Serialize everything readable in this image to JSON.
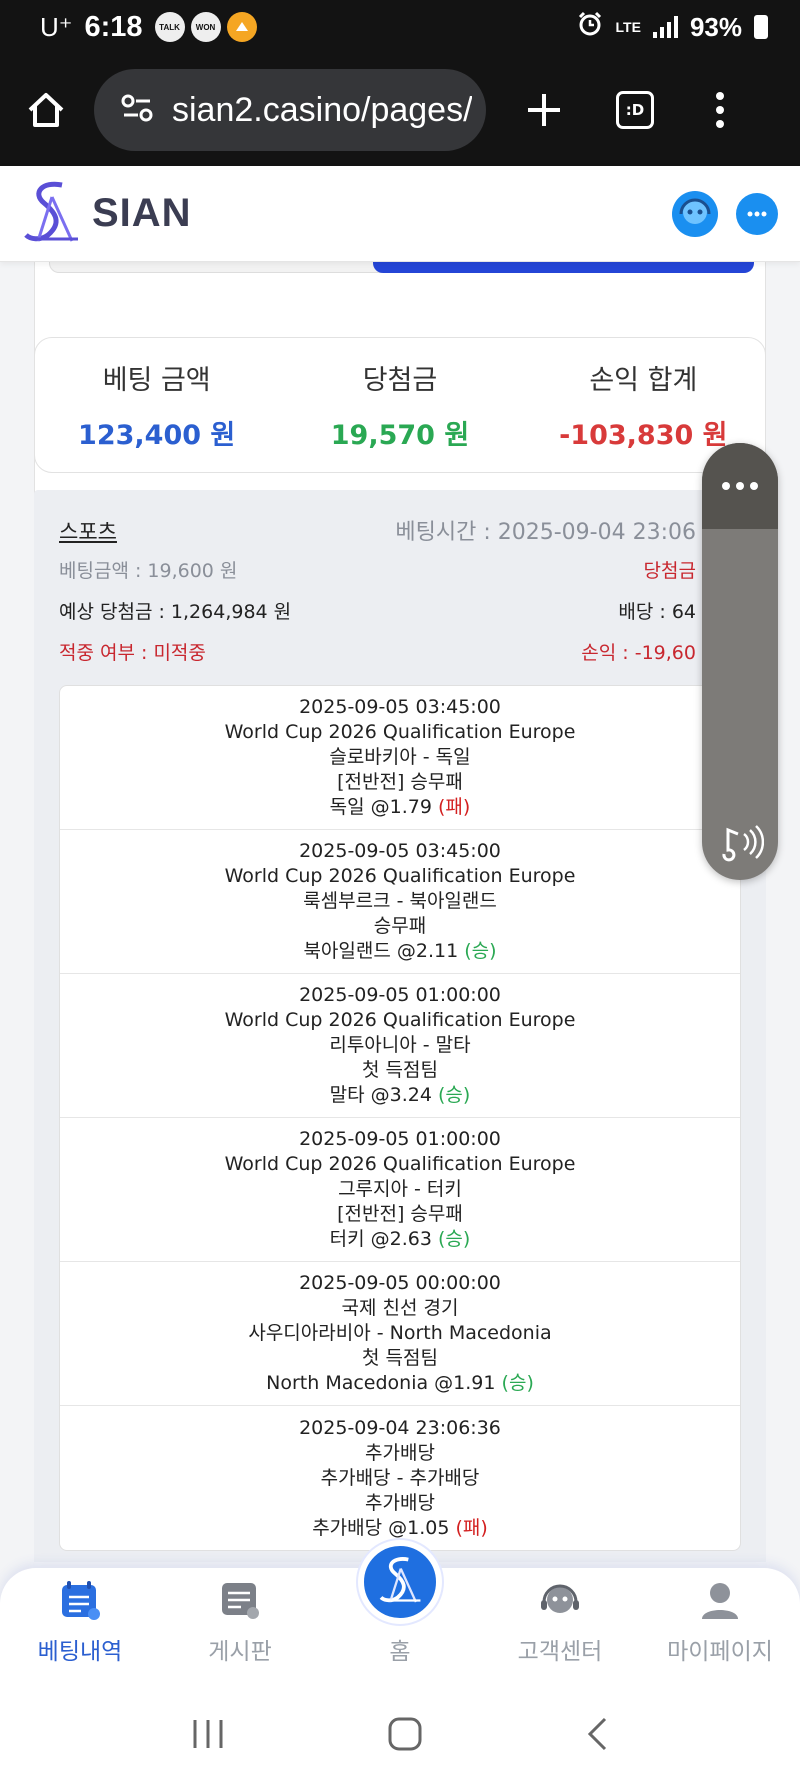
{
  "status_bar": {
    "carrier": "U⁺",
    "time": "6:18",
    "notifications": [
      "TALK",
      "WON"
    ],
    "network": "LTE",
    "battery": "93%"
  },
  "browser": {
    "url": "sian2.casino/pages/"
  },
  "site": {
    "logo_text": "SIAN"
  },
  "summary": {
    "bet_label": "베팅 금액",
    "bet_value": "123,400 원",
    "win_label": "당첨금",
    "win_value": "19,570 원",
    "pl_label": "손익 합계",
    "pl_value": "-103,830 원"
  },
  "bet": {
    "sport": "스포츠",
    "bet_time": "베팅시간 : 2025-09-04 23:06",
    "bet_amount": "베팅금액 : 19,600 원",
    "win_amount": "당첨금",
    "expected_win": "예상 당첨금 : 1,264,984 원",
    "odds": "배당 : 64",
    "hit_status": "적중 여부 : 미적중",
    "profit_loss": "손익 : -19,60"
  },
  "bet_items": [
    {
      "datetime": "2025-09-05 03:45:00",
      "league": "World Cup 2026 Qualification Europe",
      "match": "슬로바키아 - 독일",
      "market": "[전반전] 승무패",
      "pick": "독일 @1.79",
      "result": "(패)",
      "result_type": "lose"
    },
    {
      "datetime": "2025-09-05 03:45:00",
      "league": "World Cup 2026 Qualification Europe",
      "match": "룩셈부르크 - 북아일랜드",
      "market": "승무패",
      "pick": "북아일랜드 @2.11",
      "result": "(승)",
      "result_type": "win"
    },
    {
      "datetime": "2025-09-05 01:00:00",
      "league": "World Cup 2026 Qualification Europe",
      "match": "리투아니아 - 말타",
      "market": "첫 득점팀",
      "pick": "말타 @3.24",
      "result": "(승)",
      "result_type": "win"
    },
    {
      "datetime": "2025-09-05 01:00:00",
      "league": "World Cup 2026 Qualification Europe",
      "match": "그루지아 - 터키",
      "market": "[전반전] 승무패",
      "pick": "터키 @2.63",
      "result": "(승)",
      "result_type": "win"
    },
    {
      "datetime": "2025-09-05 00:00:00",
      "league": "국제 친선 경기",
      "match": "사우디아라비아 - North Macedonia",
      "market": "첫 득점팀",
      "pick": "North Macedonia @1.91",
      "result": "(승)",
      "result_type": "win"
    },
    {
      "datetime": "2025-09-04 23:06:36",
      "league": "추가배당",
      "match": "추가배당 - 추가배당",
      "market": "추가배당",
      "pick": "추가배당 @1.05",
      "result": "(패)",
      "result_type": "lose"
    }
  ],
  "bottom_nav": {
    "bet_history": "베팅내역",
    "board": "게시판",
    "home": "홈",
    "support": "고객센터",
    "mypage": "마이페이지"
  },
  "colors": {
    "accent_blue": "#2b5fd0",
    "win_green": "#2aa853",
    "loss_red": "#d83a3a",
    "button_blue": "#2445d6"
  }
}
